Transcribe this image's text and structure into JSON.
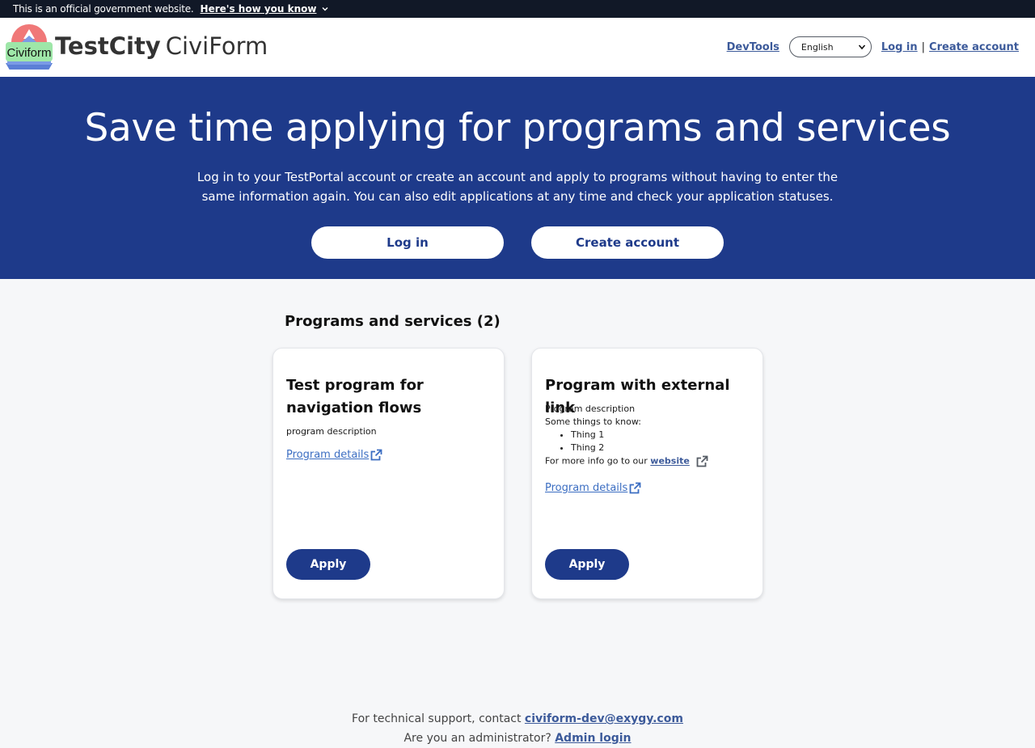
{
  "gov_banner": {
    "text": "This is an official government website.",
    "link": "Here's how you know"
  },
  "header": {
    "logo_text": "Civiform",
    "brand_city": "TestCity",
    "brand_product": "CiviForm",
    "devtools": "DevTools",
    "language_selected": "English",
    "login": "Log in",
    "separator": "|",
    "create_account": "Create account"
  },
  "hero": {
    "title": "Save time applying for programs and services",
    "description": "Log in to your TestPortal account or create an account and apply to programs without having to enter the same information again. You can also edit applications at any time and check your application statuses.",
    "login_button": "Log in",
    "create_button": "Create account"
  },
  "programs": {
    "heading": "Programs and services (2)",
    "cards": [
      {
        "title": "Test program for navigation flows",
        "description": "program description",
        "details_link": "Program details",
        "apply": "Apply"
      },
      {
        "title": "Program with external link",
        "description_line1": "Program description",
        "description_line2": "Some things to know:",
        "bullets": [
          "Thing 1",
          "Thing 2"
        ],
        "more_info_prefix": "For more info go to our",
        "more_info_link": "website",
        "details_link": "Program details",
        "apply": "Apply"
      }
    ]
  },
  "footer": {
    "support_prefix": "For technical support, contact",
    "support_email": "civiform-dev@exygy.com",
    "admin_prefix": "Are you an administrator?",
    "admin_link": "Admin login"
  },
  "colors": {
    "primary": "#1e3a8a",
    "gov_banner": "#111827",
    "link": "#3c5a9a",
    "background": "#f6f7f9"
  }
}
